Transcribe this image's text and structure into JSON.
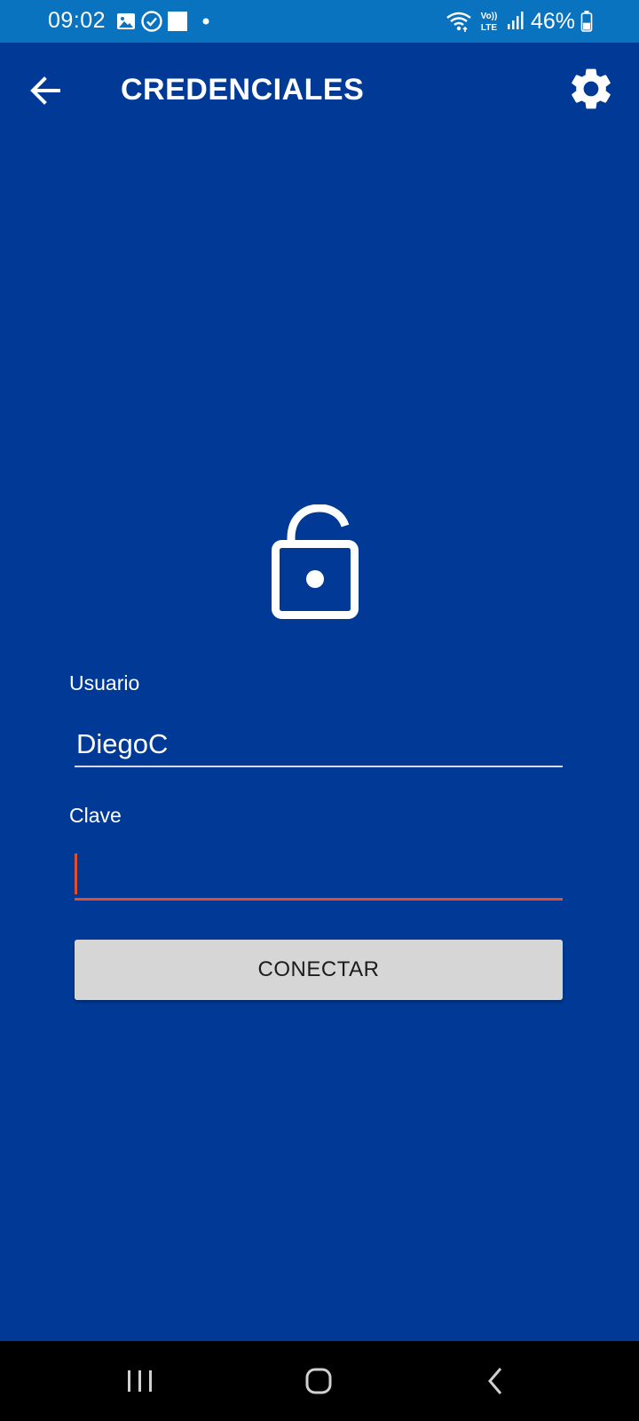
{
  "status_bar": {
    "time": "09:02",
    "battery_percent": "46%",
    "network_label_top": "Vo))",
    "network_label_bottom": "LTE",
    "icons": [
      "image-icon",
      "check-circle-icon",
      "white-square-icon",
      "dot-icon",
      "wifi-icon",
      "volte-icon",
      "signal-icon",
      "battery-icon"
    ],
    "battery_level": 0.46,
    "background_color": "#0a73bf"
  },
  "app_bar": {
    "title": "CREDENCIALES",
    "back_icon": "arrow-left-icon",
    "settings_icon": "gear-icon"
  },
  "content": {
    "lock_icon": "unlocked-padlock-icon",
    "username": {
      "label": "Usuario",
      "value": "DiegoC"
    },
    "password": {
      "label": "Clave",
      "value": ""
    },
    "connect_button": "CONECTAR"
  },
  "nav_bar": {
    "icons": [
      "recents-icon",
      "home-icon",
      "back-icon"
    ]
  },
  "colors": {
    "background": "#003a96",
    "focus_accent": "#e04e2e",
    "button": "#d6d6d6",
    "text": "#ffffff"
  }
}
